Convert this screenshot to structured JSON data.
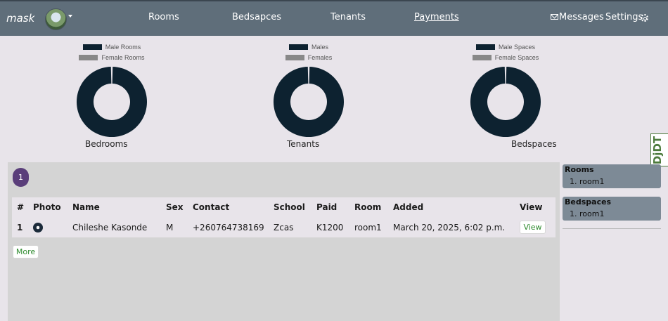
{
  "navbar": {
    "brand": "mask",
    "links": [
      "Rooms",
      "Bedsapces",
      "Tenants",
      "Payments"
    ],
    "active_link": "Payments",
    "messages_label": "Messages",
    "settings_label": "Settings"
  },
  "colors": {
    "navbar_bg": "#5f6e7a",
    "series_primary": "#0d2230",
    "series_secondary": "#888888",
    "page_badge": "#5a3e7a",
    "sidebar_card": "#7d8a96",
    "button_text": "#2e8b2e"
  },
  "chart_data": [
    {
      "type": "pie",
      "title": "Bedrooms",
      "series": [
        {
          "name": "Male Rooms",
          "values": [
            1
          ]
        },
        {
          "name": "Female Rooms",
          "values": [
            0
          ]
        }
      ]
    },
    {
      "type": "pie",
      "title": "Tenants",
      "series": [
        {
          "name": "Males",
          "values": [
            1
          ]
        },
        {
          "name": "Females",
          "values": [
            0
          ]
        }
      ]
    },
    {
      "type": "pie",
      "title": "Bedspaces",
      "series": [
        {
          "name": "Male Spaces",
          "values": [
            1
          ]
        },
        {
          "name": "Female Spaces",
          "values": [
            0
          ]
        }
      ]
    }
  ],
  "main": {
    "page_number": "1",
    "table": {
      "headers": [
        "#",
        "Photo",
        "Name",
        "Sex",
        "Contact",
        "School",
        "Paid",
        "Room",
        "Added",
        "View"
      ],
      "rows": [
        {
          "index": "1",
          "name": "Chileshe Kasonde",
          "sex": "M",
          "contact": "+260764738169",
          "school": "Zcas",
          "paid": "K1200",
          "room": "room1",
          "added": "March 20, 2025, 6:02 p.m.",
          "view_label": "View"
        }
      ]
    },
    "more_label": "More"
  },
  "sidebar": {
    "rooms": {
      "title": "Rooms",
      "items": [
        "1. room1"
      ]
    },
    "bedspaces": {
      "title": "Bedspaces",
      "items": [
        "1. room1"
      ]
    }
  },
  "debug_toolbar": {
    "label": "DjDT"
  }
}
